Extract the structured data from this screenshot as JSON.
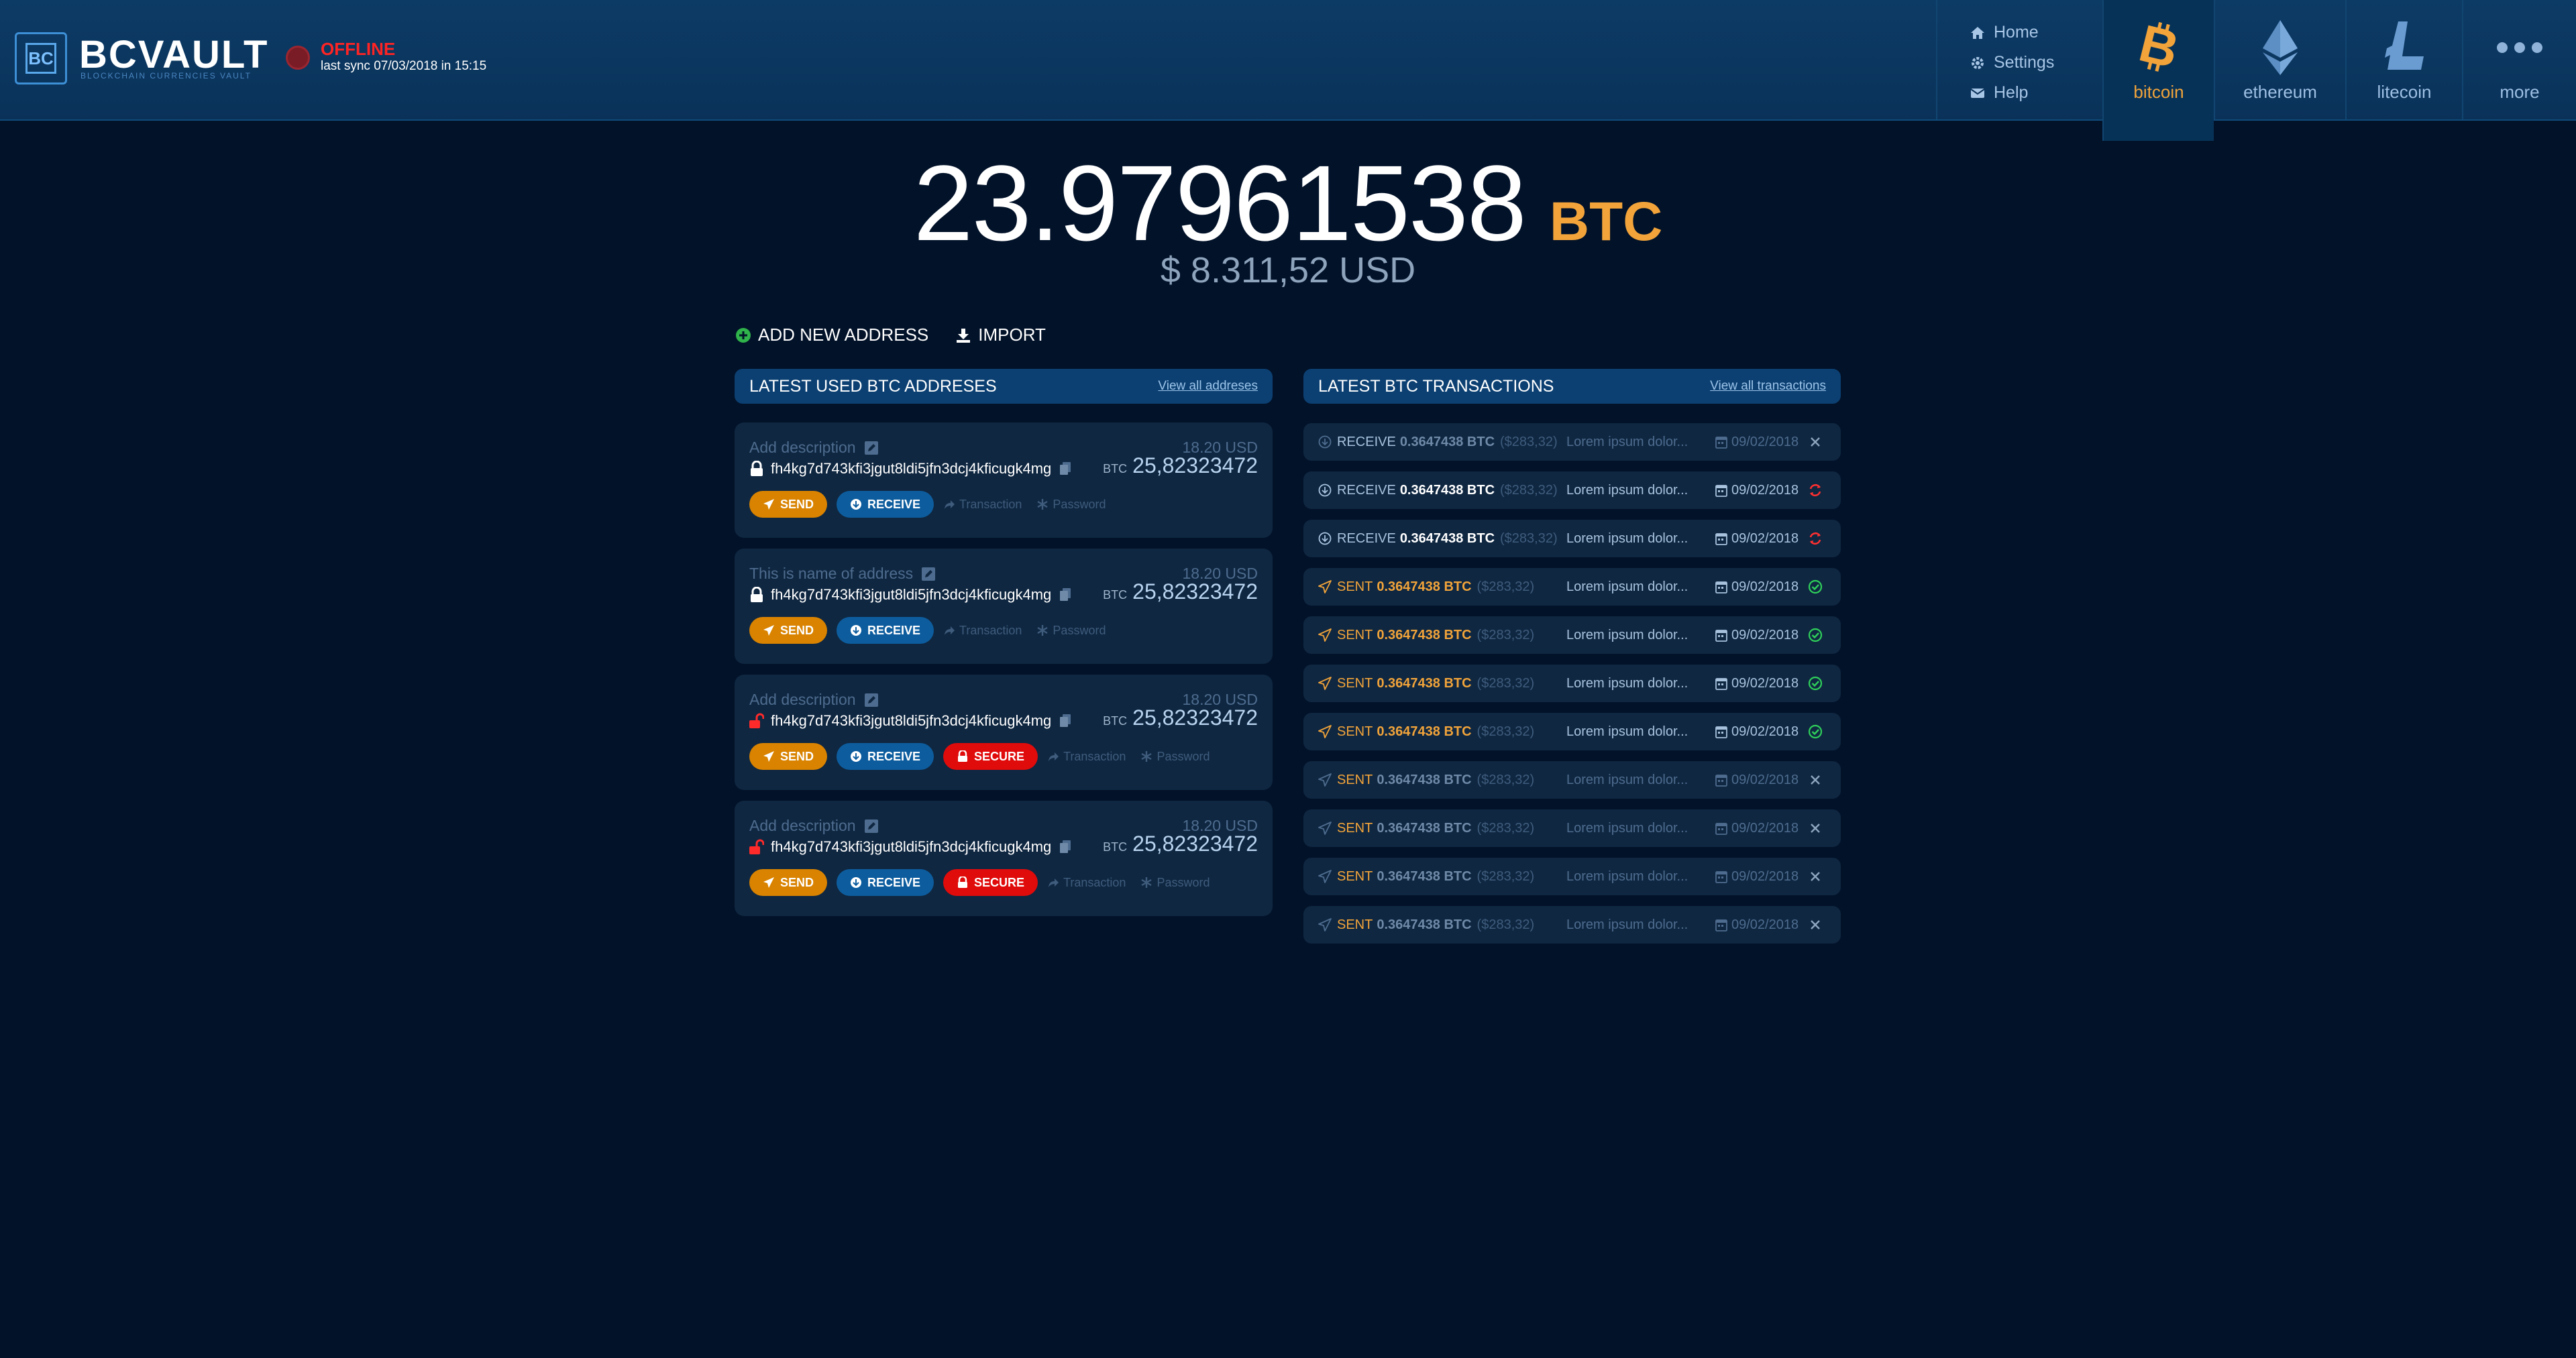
{
  "app": {
    "logo_mark": "BC",
    "name": "BCVAULT",
    "tagline": "BLOCKCHAIN CURRENCIES VAULT",
    "status": "OFFLINE",
    "last_sync": "last sync 07/03/2018 in 15:15"
  },
  "nav": {
    "links": [
      {
        "label": "Home",
        "icon": "home-icon"
      },
      {
        "label": "Settings",
        "icon": "gear-icon"
      },
      {
        "label": "Help",
        "icon": "envelope-icon"
      }
    ],
    "coins": [
      {
        "label": "bitcoin",
        "icon": "bitcoin-icon",
        "active": true
      },
      {
        "label": "ethereum",
        "icon": "ethereum-icon",
        "active": false
      },
      {
        "label": "litecoin",
        "icon": "litecoin-icon",
        "active": false
      },
      {
        "label": "more",
        "icon": "more-dots-icon",
        "active": false
      }
    ]
  },
  "balance": {
    "amount": "23.97961538",
    "unit": "BTC",
    "usd": "$ 8.311,52 USD"
  },
  "actions": {
    "add_address": "ADD NEW ADDRESS",
    "import": "IMPORT"
  },
  "addresses_panel": {
    "title": "LATEST USED BTC ADDRESES",
    "link": "View all addreses",
    "items": [
      {
        "description": "Add description",
        "usd": "18.20 USD",
        "address": "fh4kg7d743kfi3jgut8ldi5jfn3dcj4kficugk4mg",
        "unit": "BTC",
        "amount": "25,82323472",
        "locked": true,
        "secure": false
      },
      {
        "description": "This is name of address",
        "usd": "18.20 USD",
        "address": "fh4kg7d743kfi3jgut8ldi5jfn3dcj4kficugk4mg",
        "unit": "BTC",
        "amount": "25,82323472",
        "locked": true,
        "secure": false
      },
      {
        "description": "Add description",
        "usd": "18.20 USD",
        "address": "fh4kg7d743kfi3jgut8ldi5jfn3dcj4kficugk4mg",
        "unit": "BTC",
        "amount": "25,82323472",
        "locked": false,
        "secure": true
      },
      {
        "description": "Add description",
        "usd": "18.20 USD",
        "address": "fh4kg7d743kfi3jgut8ldi5jfn3dcj4kficugk4mg",
        "unit": "BTC",
        "amount": "25,82323472",
        "locked": false,
        "secure": true
      }
    ],
    "labels": {
      "send": "SEND",
      "receive": "RECEIVE",
      "secure": "SECURE",
      "transaction": "Transaction",
      "password": "Password"
    }
  },
  "transactions_panel": {
    "title": "LATEST BTC TRANSACTIONS",
    "link": "View all transactions",
    "items": [
      {
        "type": "RECEIVE",
        "amount": "0.3647438 BTC",
        "usd": "($283,32)",
        "desc": "Lorem ipsum dolor...",
        "date": "09/02/2018",
        "status": "cancelled",
        "dim": true
      },
      {
        "type": "RECEIVE",
        "amount": "0.3647438 BTC",
        "usd": "($283,32)",
        "desc": "Lorem ipsum dolor...",
        "date": "09/02/2018",
        "status": "pending",
        "dim": false
      },
      {
        "type": "RECEIVE",
        "amount": "0.3647438 BTC",
        "usd": "($283,32)",
        "desc": "Lorem ipsum dolor...",
        "date": "09/02/2018",
        "status": "pending",
        "dim": false
      },
      {
        "type": "SENT",
        "amount": "0.3647438 BTC",
        "usd": "($283,32)",
        "desc": "Lorem ipsum dolor...",
        "date": "09/02/2018",
        "status": "confirmed",
        "dim": false
      },
      {
        "type": "SENT",
        "amount": "0.3647438 BTC",
        "usd": "($283,32)",
        "desc": "Lorem ipsum dolor...",
        "date": "09/02/2018",
        "status": "confirmed",
        "dim": false
      },
      {
        "type": "SENT",
        "amount": "0.3647438 BTC",
        "usd": "($283,32)",
        "desc": "Lorem ipsum dolor...",
        "date": "09/02/2018",
        "status": "confirmed",
        "dim": false
      },
      {
        "type": "SENT",
        "amount": "0.3647438 BTC",
        "usd": "($283,32)",
        "desc": "Lorem ipsum dolor...",
        "date": "09/02/2018",
        "status": "confirmed",
        "dim": false
      },
      {
        "type": "SENT",
        "amount": "0.3647438 BTC",
        "usd": "($283,32)",
        "desc": "Lorem ipsum dolor...",
        "date": "09/02/2018",
        "status": "cancelled",
        "dim": true
      },
      {
        "type": "SENT",
        "amount": "0.3647438 BTC",
        "usd": "($283,32)",
        "desc": "Lorem ipsum dolor...",
        "date": "09/02/2018",
        "status": "cancelled",
        "dim": true
      },
      {
        "type": "SENT",
        "amount": "0.3647438 BTC",
        "usd": "($283,32)",
        "desc": "Lorem ipsum dolor...",
        "date": "09/02/2018",
        "status": "cancelled",
        "dim": true
      },
      {
        "type": "SENT",
        "amount": "0.3647438 BTC",
        "usd": "($283,32)",
        "desc": "Lorem ipsum dolor...",
        "date": "09/02/2018",
        "status": "cancelled",
        "dim": true
      }
    ]
  },
  "colors": {
    "background": "#021229",
    "header": "#0c3b66",
    "accent_orange": "#f2a43a",
    "send": "#d98300",
    "receive": "#0d5d9e",
    "secure": "#e00b0b",
    "offline": "#ff2424",
    "confirmed": "#2fd05a",
    "pending": "#ff3030"
  }
}
